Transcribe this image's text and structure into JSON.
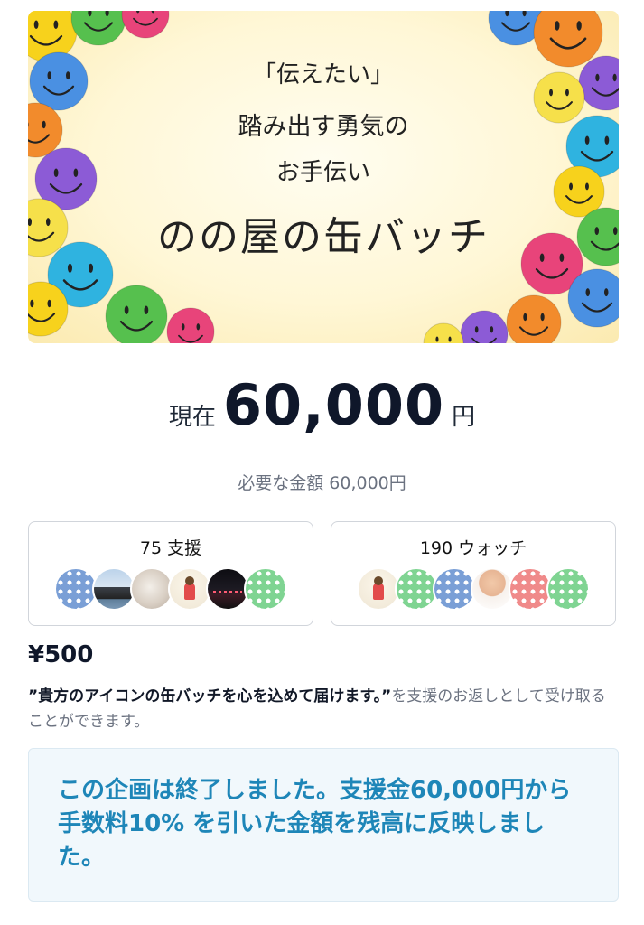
{
  "hero": {
    "line1": "「伝えたい」",
    "line2": "踏み出す勇気の",
    "line3": "お手伝い",
    "title": "のの屋の缶バッチ"
  },
  "current": {
    "prefix": "現在",
    "amount": "60,000",
    "unit": "円"
  },
  "goal": {
    "text": "必要な金額 60,000円"
  },
  "supporters": {
    "label": "75 支援",
    "avatars": [
      "dot-blue",
      "photo-island",
      "photo-pig",
      "photo-drawing",
      "photo-night",
      "dot-green"
    ]
  },
  "watchers": {
    "label": "190 ウォッチ",
    "avatars": [
      "photo-drawing",
      "dot-green",
      "dot-blue",
      "photo-baby",
      "dot-red",
      "dot-green"
    ]
  },
  "reward": {
    "price": "¥500",
    "desc_quote": "”貴方のアイコンの缶バッチを心を込めて届けます。”",
    "desc_rest": "を支援のお返しとして受け取ることができます。"
  },
  "notice": {
    "text": "この企画は終了しました。支援金60,000円から手数料10% を引いた金額を残高に反映しました。"
  },
  "colors": {
    "accent_blue": "#1e86b8",
    "notice_bg": "#f1f8fc",
    "muted_text": "#6b7280"
  }
}
